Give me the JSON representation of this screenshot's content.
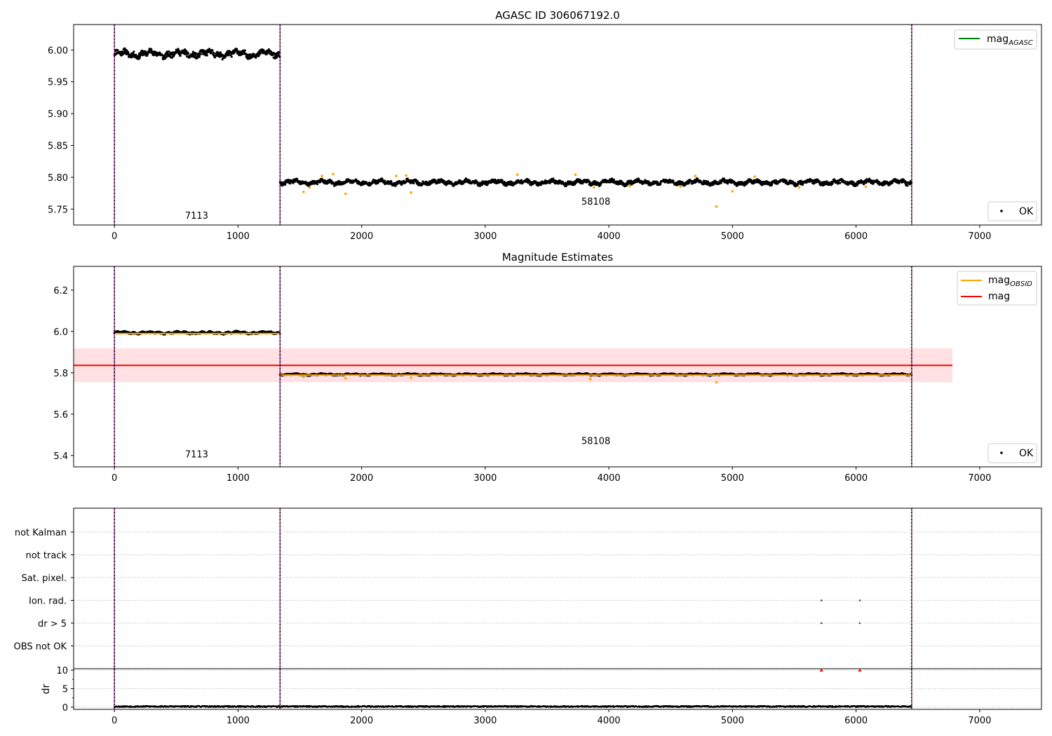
{
  "chart_data": [
    {
      "type": "scatter",
      "title": "AGASC ID 306067192.0",
      "xlim": [
        -330,
        7500
      ],
      "ylim": [
        5.725,
        6.04
      ],
      "xticks": [
        0,
        1000,
        2000,
        3000,
        4000,
        5000,
        6000,
        7000
      ],
      "yticks": [
        5.75,
        5.8,
        5.85,
        5.9,
        5.95,
        6.0
      ],
      "ytick_labels": [
        "5.75",
        "5.80",
        "5.85",
        "5.90",
        "5.95",
        "6.00"
      ],
      "obs_boundaries": [
        0,
        1340,
        6450
      ],
      "obs_labels": [
        {
          "text": "7113",
          "x": 665,
          "y": 5.735
        },
        {
          "text": "58108",
          "x": 3895,
          "y": 5.757
        }
      ],
      "segments": [
        {
          "x_start": 0,
          "x_end": 1340,
          "level": 5.994,
          "spread": 0.009
        },
        {
          "x_start": 1340,
          "x_end": 6450,
          "level": 5.792,
          "spread": 0.006
        }
      ],
      "outliers": [
        {
          "x": 1530,
          "y": 5.777
        },
        {
          "x": 1580,
          "y": 5.784
        },
        {
          "x": 1680,
          "y": 5.802
        },
        {
          "x": 1770,
          "y": 5.805
        },
        {
          "x": 1870,
          "y": 5.774
        },
        {
          "x": 2280,
          "y": 5.802
        },
        {
          "x": 2360,
          "y": 5.803
        },
        {
          "x": 2400,
          "y": 5.776
        },
        {
          "x": 3260,
          "y": 5.804
        },
        {
          "x": 3730,
          "y": 5.804
        },
        {
          "x": 3880,
          "y": 5.784
        },
        {
          "x": 4170,
          "y": 5.786
        },
        {
          "x": 4580,
          "y": 5.785
        },
        {
          "x": 4700,
          "y": 5.802
        },
        {
          "x": 4870,
          "y": 5.754
        },
        {
          "x": 5000,
          "y": 5.778
        },
        {
          "x": 5180,
          "y": 5.801
        },
        {
          "x": 5540,
          "y": 5.784
        },
        {
          "x": 6080,
          "y": 5.785
        }
      ],
      "legend_lines": [
        {
          "label": "mag",
          "subscript": "AGASC",
          "color": "#008000"
        }
      ],
      "legend_markers": [
        {
          "label": "OK",
          "color": "#000000"
        }
      ],
      "colors": {
        "ok": "#000000",
        "outlier": "#ffa500",
        "boundary": "#800080"
      }
    },
    {
      "type": "scatter",
      "title": "Magnitude Estimates",
      "xlim": [
        -330,
        7500
      ],
      "ylim": [
        5.345,
        6.315
      ],
      "xticks": [
        0,
        1000,
        2000,
        3000,
        4000,
        5000,
        6000,
        7000
      ],
      "yticks": [
        5.4,
        5.6,
        5.8,
        6.0,
        6.2
      ],
      "ytick_labels": [
        "5.4",
        "5.6",
        "5.8",
        "6.0",
        "6.2"
      ],
      "obs_boundaries": [
        0,
        1340,
        6450
      ],
      "obs_labels": [
        {
          "text": "7113",
          "x": 665,
          "y": 5.39
        },
        {
          "text": "58108",
          "x": 3895,
          "y": 5.455
        }
      ],
      "mag_line": {
        "value": 5.836,
        "x_end": 6780,
        "band": [
          5.755,
          5.918
        ]
      },
      "obsid_segments": [
        {
          "x_start": 0,
          "x_end": 1340,
          "value": 5.99
        },
        {
          "x_start": 1340,
          "x_end": 6450,
          "value": 5.789
        }
      ],
      "segments": [
        {
          "x_start": 0,
          "x_end": 1340,
          "level": 5.994,
          "spread": 0.009
        },
        {
          "x_start": 1340,
          "x_end": 6450,
          "level": 5.792,
          "spread": 0.006
        }
      ],
      "outliers": [
        {
          "x": 1530,
          "y": 5.78
        },
        {
          "x": 1870,
          "y": 5.773
        },
        {
          "x": 2400,
          "y": 5.776
        },
        {
          "x": 3850,
          "y": 5.77
        },
        {
          "x": 4870,
          "y": 5.754
        }
      ],
      "legend_lines": [
        {
          "label": "mag",
          "subscript": "OBSID",
          "color": "#ffa500"
        },
        {
          "label": "mag",
          "subscript": "",
          "color": "#ff0000"
        }
      ],
      "legend_markers": [
        {
          "label": "OK",
          "color": "#000000"
        }
      ],
      "colors": {
        "ok": "#000000",
        "outlier": "#ffa500",
        "boundary": "#800080",
        "band": "#ffd6da",
        "mag": "#ff0000"
      }
    },
    {
      "type": "scatter",
      "xlim": [
        -330,
        7500
      ],
      "flag_rows": [
        "not Kalman",
        "not track",
        "Sat. pixel.",
        "Ion. rad.",
        "dr > 5",
        "OBS not OK"
      ],
      "flag_points": [
        {
          "x": 5720,
          "flag": "Ion. rad."
        },
        {
          "x": 6030,
          "flag": "Ion. rad."
        },
        {
          "x": 5720,
          "flag": "dr > 5"
        },
        {
          "x": 6030,
          "flag": "dr > 5"
        }
      ],
      "obs_boundaries": [
        0,
        1340,
        6450
      ],
      "colors": {
        "boundary": "#800080",
        "point": "#444444"
      }
    },
    {
      "type": "scatter",
      "ylabel": "dr",
      "xlim": [
        -330,
        7500
      ],
      "ylim": [
        -0.6,
        10.4
      ],
      "xticks": [
        0,
        1000,
        2000,
        3000,
        4000,
        5000,
        6000,
        7000
      ],
      "yticks": [
        0,
        5,
        10
      ],
      "ytick_labels": [
        "0",
        "5",
        "10"
      ],
      "obs_boundaries": [
        0,
        1340,
        6450
      ],
      "baseline": {
        "x_start": 0,
        "x_end": 6450,
        "level": 0.1,
        "spread": 0.12
      },
      "clipped_points": [
        {
          "x": 5720,
          "y": 10
        },
        {
          "x": 6030,
          "y": 10
        }
      ],
      "colors": {
        "ok": "#000000",
        "clipped": "#ff0000",
        "boundary": "#800080"
      }
    }
  ]
}
